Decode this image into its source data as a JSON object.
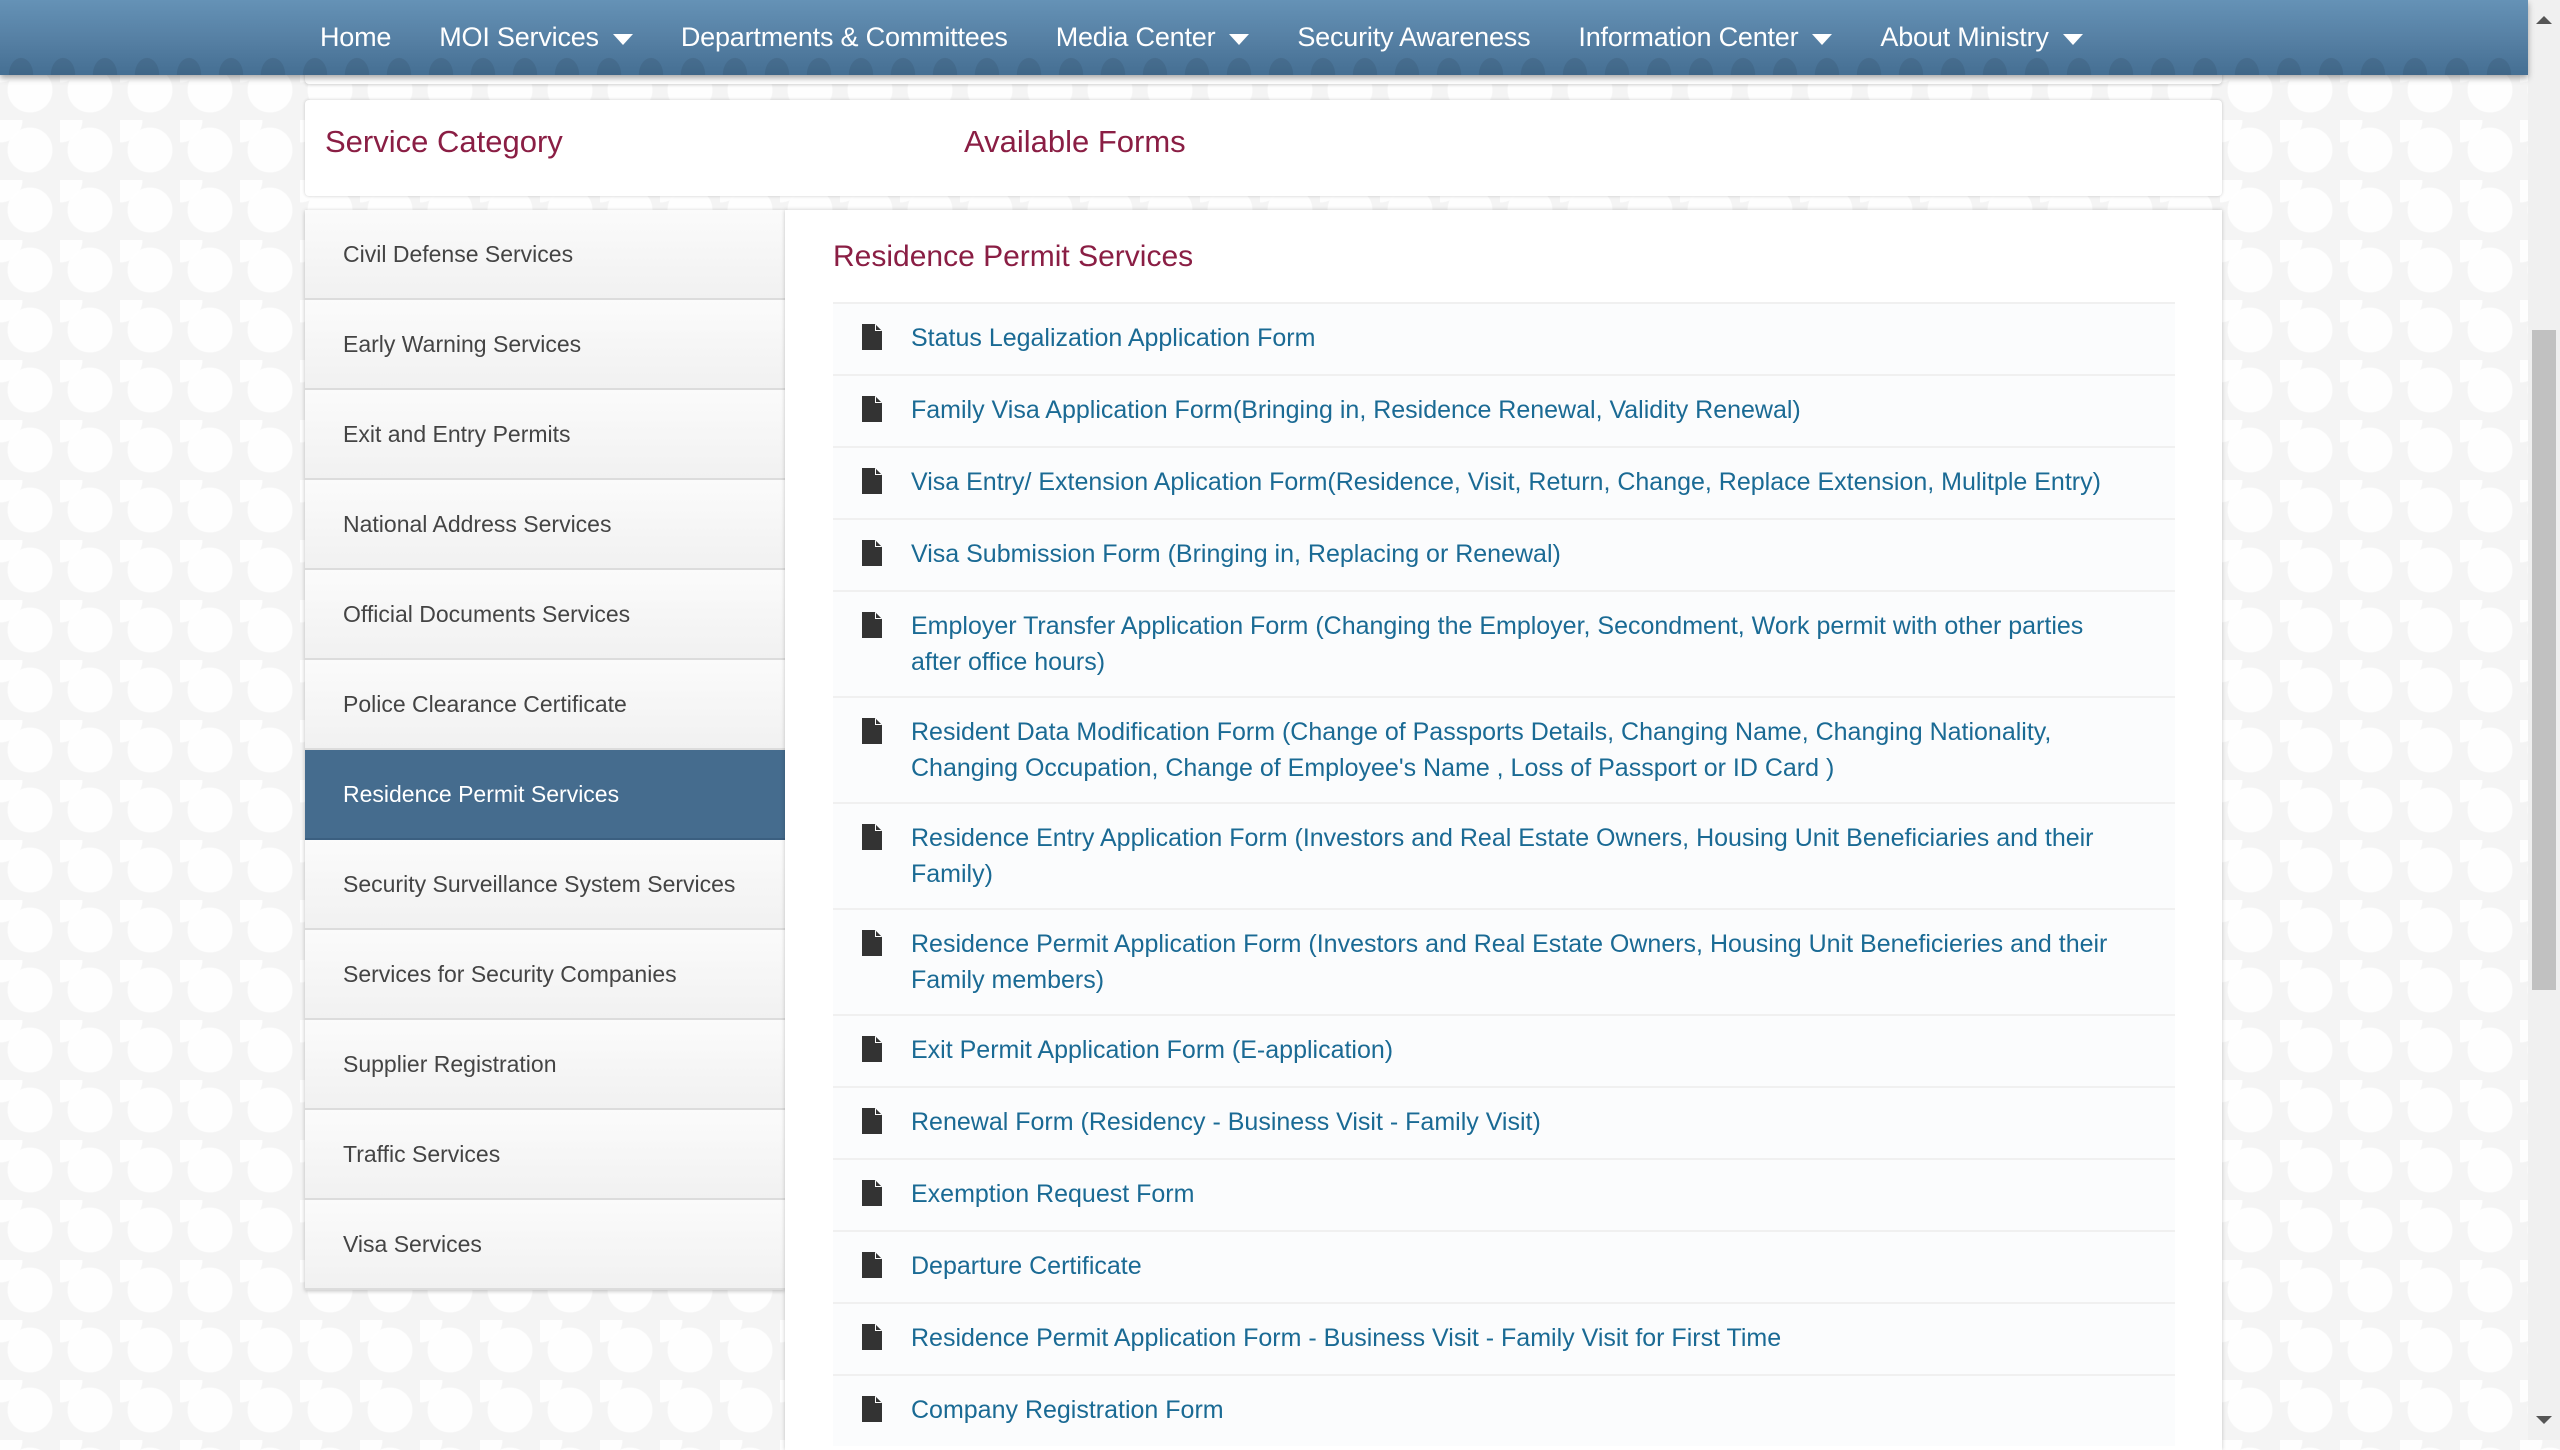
{
  "nav": {
    "items": [
      {
        "label": "Home",
        "has_dropdown": false
      },
      {
        "label": "MOI Services",
        "has_dropdown": true
      },
      {
        "label": "Departments & Committees",
        "has_dropdown": false
      },
      {
        "label": "Media Center",
        "has_dropdown": true
      },
      {
        "label": "Security Awareness",
        "has_dropdown": false
      },
      {
        "label": "Information Center",
        "has_dropdown": true
      },
      {
        "label": "About Ministry",
        "has_dropdown": true
      }
    ]
  },
  "header": {
    "service_category_label": "Service Category",
    "available_forms_label": "Available Forms"
  },
  "sidebar": {
    "active_index": 6,
    "items": [
      {
        "label": "Civil Defense Services"
      },
      {
        "label": "Early Warning Services"
      },
      {
        "label": "Exit and Entry Permits"
      },
      {
        "label": "National Address Services"
      },
      {
        "label": "Official Documents Services"
      },
      {
        "label": "Police Clearance Certificate"
      },
      {
        "label": "Residence Permit Services"
      },
      {
        "label": "Security Surveillance System Services"
      },
      {
        "label": "Services for Security Companies"
      },
      {
        "label": "Supplier Registration"
      },
      {
        "label": "Traffic Services"
      },
      {
        "label": "Visa Services"
      }
    ]
  },
  "content": {
    "title": "Residence Permit Services",
    "icon": "file-icon",
    "forms": [
      {
        "label": "Status Legalization Application Form"
      },
      {
        "label": "Family Visa Application Form(Bringing in, Residence Renewal, Validity Renewal)"
      },
      {
        "label": "Visa Entry/ Extension Aplication Form(Residence, Visit, Return, Change, Replace Extension, Mulitple Entry)"
      },
      {
        "label": "Visa Submission Form (Bringing in, Replacing or Renewal)"
      },
      {
        "label": "Employer Transfer Application Form (Changing the Employer, Secondment, Work permit with other parties after office hours)"
      },
      {
        "label": "Resident Data Modification Form (Change of Passports Details, Changing Name, Changing Nationality, Changing Occupation, Change of Employee's Name , Loss of Passport or ID Card )"
      },
      {
        "label": "Residence Entry Application Form (Investors and Real Estate Owners, Housing Unit Beneficiaries and their Family)"
      },
      {
        "label": "Residence Permit Application Form (Investors and Real Estate Owners, Housing Unit Beneficieries and their Family members)"
      },
      {
        "label": "Exit Permit Application Form (E-application)"
      },
      {
        "label": "Renewal Form (Residency - Business Visit - Family Visit)"
      },
      {
        "label": "Exemption Request Form"
      },
      {
        "label": "Departure Certificate"
      },
      {
        "label": "Residence Permit Application Form - Business Visit - Family Visit for First Time"
      },
      {
        "label": "Company Registration Form"
      }
    ]
  },
  "colors": {
    "nav_blue": "#557fa3",
    "active_item": "#456c8e",
    "heading_maroon": "#8a1e44",
    "link_blue": "#1a6a94"
  }
}
